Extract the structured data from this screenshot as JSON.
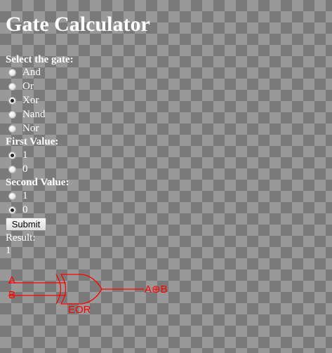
{
  "page": {
    "title": "Gate Calculator"
  },
  "gate_select": {
    "label": "Select the gate:",
    "options": [
      {
        "label": "And",
        "checked": false
      },
      {
        "label": "Or",
        "checked": false
      },
      {
        "label": "Xor",
        "checked": true
      },
      {
        "label": "Nand",
        "checked": false
      },
      {
        "label": "Nor",
        "checked": false
      }
    ]
  },
  "first_value": {
    "label": "First Value:",
    "options": [
      {
        "label": "1",
        "checked": true
      },
      {
        "label": "0",
        "checked": false
      }
    ]
  },
  "second_value": {
    "label": "Second Value:",
    "options": [
      {
        "label": "1",
        "checked": false
      },
      {
        "label": "0",
        "checked": true
      }
    ]
  },
  "submit": {
    "label": "Submit"
  },
  "result": {
    "label": "Result:",
    "value": "1"
  },
  "diagram": {
    "input_a": "A",
    "input_b": "B",
    "output": "A⊕B",
    "gate_name": "EOR",
    "color": "#ff0000"
  }
}
